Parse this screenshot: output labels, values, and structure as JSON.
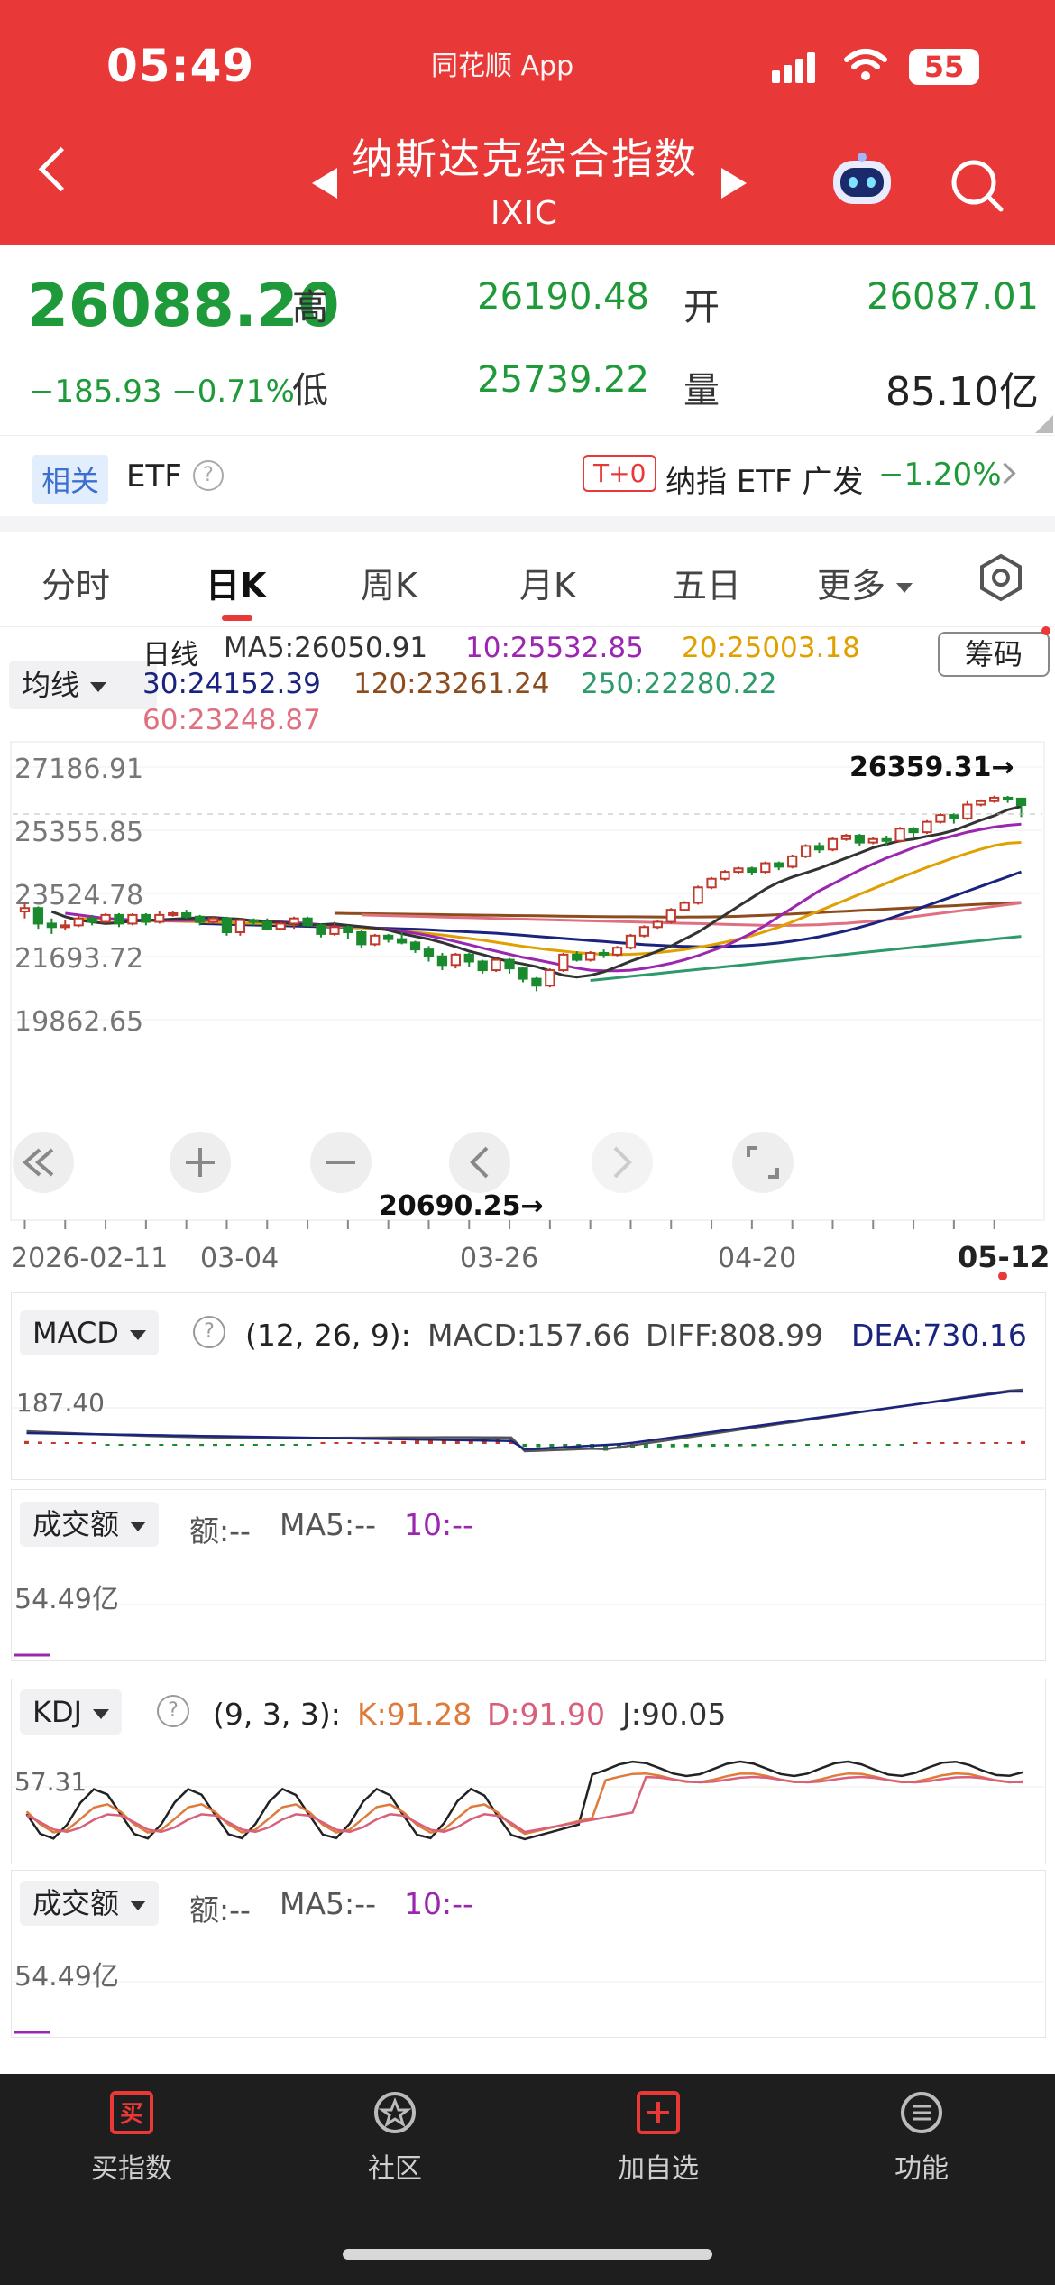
{
  "status_bar": {
    "time": "05:49",
    "app_name": "同花顺 App",
    "battery": "55"
  },
  "header": {
    "title": "纳斯达克综合指数",
    "code": "IXIC"
  },
  "quote": {
    "price": "26088.20",
    "change": "−185.93  −0.71%",
    "high_label": "高",
    "high": "26190.48",
    "open_label": "开",
    "open": "26087.01",
    "low_label": "低",
    "low": "25739.22",
    "volume_label": "量",
    "volume": "85.10亿"
  },
  "related": {
    "tag": "相关",
    "etf_label": "ETF",
    "t0": "T+0",
    "etf_name": "纳指 ETF 广发",
    "etf_change": "−1.20%"
  },
  "tabs": [
    {
      "label": "分时"
    },
    {
      "label": "日K"
    },
    {
      "label": "周K"
    },
    {
      "label": "月K"
    },
    {
      "label": "五日"
    },
    {
      "label": "更多"
    }
  ],
  "ma_legend": {
    "selector": "均线",
    "period": "日线",
    "ma5": "MA5:26050.91",
    "ma10": "10:25532.85",
    "ma20": "20:25003.18",
    "ma30": "30:24152.39",
    "ma120": "120:23261.24",
    "ma250": "250:22280.22",
    "ma60": "60:23248.87",
    "chip_button": "筹码"
  },
  "colors": {
    "up": "#c0392b",
    "down": "#1a8a2e",
    "ma5": "#333333",
    "ma10": "#9b27b0",
    "ma20": "#e0a000",
    "ma30": "#1a237e",
    "ma120": "#8d4c1e",
    "ma250": "#2e9a6b",
    "ma60": "#e07080"
  },
  "chart_data": {
    "type": "candlestick",
    "y_axis_labels": [
      "27186.91",
      "25355.85",
      "23524.78",
      "21693.72",
      "19862.65"
    ],
    "ylim": [
      19862.65,
      27186.91
    ],
    "x_axis_labels": [
      "2026-02-11",
      "03-04",
      "03-26",
      "04-20",
      "05-12"
    ],
    "annotations": {
      "high_marker": "26359.31→",
      "low_marker": "20690.25→"
    },
    "candles": [
      {
        "o": 23000,
        "c": 23100,
        "h": 23250,
        "l": 22800
      },
      {
        "o": 23100,
        "c": 22650,
        "h": 23150,
        "l": 22500
      },
      {
        "o": 22650,
        "c": 22550,
        "h": 22800,
        "l": 22350
      },
      {
        "o": 22550,
        "c": 22600,
        "h": 22750,
        "l": 22450
      },
      {
        "o": 22600,
        "c": 22800,
        "h": 22900,
        "l": 22550
      },
      {
        "o": 22800,
        "c": 22700,
        "h": 22900,
        "l": 22600
      },
      {
        "o": 22700,
        "c": 22900,
        "h": 22950,
        "l": 22650
      },
      {
        "o": 22900,
        "c": 22650,
        "h": 22950,
        "l": 22550
      },
      {
        "o": 22650,
        "c": 22900,
        "h": 22950,
        "l": 22600
      },
      {
        "o": 22900,
        "c": 22700,
        "h": 22950,
        "l": 22600
      },
      {
        "o": 22700,
        "c": 22900,
        "h": 23000,
        "l": 22650
      },
      {
        "o": 22900,
        "c": 22950,
        "h": 23000,
        "l": 22850
      },
      {
        "o": 22950,
        "c": 22850,
        "h": 23050,
        "l": 22800
      },
      {
        "o": 22850,
        "c": 22700,
        "h": 22900,
        "l": 22600
      },
      {
        "o": 22700,
        "c": 22800,
        "h": 22850,
        "l": 22650
      },
      {
        "o": 22800,
        "c": 22400,
        "h": 22850,
        "l": 22300
      },
      {
        "o": 22400,
        "c": 22750,
        "h": 22800,
        "l": 22300
      },
      {
        "o": 22750,
        "c": 22700,
        "h": 22800,
        "l": 22600
      },
      {
        "o": 22700,
        "c": 22500,
        "h": 22800,
        "l": 22450
      },
      {
        "o": 22500,
        "c": 22650,
        "h": 22700,
        "l": 22450
      },
      {
        "o": 22650,
        "c": 22800,
        "h": 22850,
        "l": 22500
      },
      {
        "o": 22800,
        "c": 22600,
        "h": 22850,
        "l": 22550
      },
      {
        "o": 22600,
        "c": 22350,
        "h": 22650,
        "l": 22250
      },
      {
        "o": 22350,
        "c": 22550,
        "h": 22700,
        "l": 22300
      },
      {
        "o": 22550,
        "c": 22400,
        "h": 22600,
        "l": 22200
      },
      {
        "o": 22400,
        "c": 22050,
        "h": 22450,
        "l": 21950
      },
      {
        "o": 22050,
        "c": 22300,
        "h": 22350,
        "l": 22000
      },
      {
        "o": 22300,
        "c": 22200,
        "h": 22350,
        "l": 22100
      },
      {
        "o": 22200,
        "c": 22100,
        "h": 22400,
        "l": 22050
      },
      {
        "o": 22100,
        "c": 21900,
        "h": 22150,
        "l": 21800
      },
      {
        "o": 21900,
        "c": 21700,
        "h": 22000,
        "l": 21550
      },
      {
        "o": 21700,
        "c": 21450,
        "h": 21800,
        "l": 21300
      },
      {
        "o": 21450,
        "c": 21750,
        "h": 21800,
        "l": 21350
      },
      {
        "o": 21750,
        "c": 21550,
        "h": 21800,
        "l": 21400
      },
      {
        "o": 21550,
        "c": 21300,
        "h": 21600,
        "l": 21200
      },
      {
        "o": 21300,
        "c": 21600,
        "h": 21650,
        "l": 21250
      },
      {
        "o": 21600,
        "c": 21350,
        "h": 21650,
        "l": 21200
      },
      {
        "o": 21350,
        "c": 21050,
        "h": 21400,
        "l": 20950
      },
      {
        "o": 21050,
        "c": 20850,
        "h": 21100,
        "l": 20690
      },
      {
        "o": 20850,
        "c": 21300,
        "h": 21350,
        "l": 20800
      },
      {
        "o": 21300,
        "c": 21750,
        "h": 21800,
        "l": 21250
      },
      {
        "o": 21750,
        "c": 21600,
        "h": 21850,
        "l": 21550
      },
      {
        "o": 21600,
        "c": 21800,
        "h": 21850,
        "l": 21550
      },
      {
        "o": 21800,
        "c": 21750,
        "h": 21900,
        "l": 21650
      },
      {
        "o": 21750,
        "c": 21950,
        "h": 22000,
        "l": 21700
      },
      {
        "o": 21950,
        "c": 22300,
        "h": 22350,
        "l": 21900
      },
      {
        "o": 22300,
        "c": 22550,
        "h": 22600,
        "l": 22250
      },
      {
        "o": 22550,
        "c": 22700,
        "h": 22750,
        "l": 22500
      },
      {
        "o": 22700,
        "c": 23050,
        "h": 23100,
        "l": 22650
      },
      {
        "o": 23050,
        "c": 23250,
        "h": 23300,
        "l": 23000
      },
      {
        "o": 23250,
        "c": 23700,
        "h": 23750,
        "l": 23200
      },
      {
        "o": 23700,
        "c": 23950,
        "h": 24000,
        "l": 23650
      },
      {
        "o": 23950,
        "c": 24150,
        "h": 24200,
        "l": 23900
      },
      {
        "o": 24150,
        "c": 24250,
        "h": 24300,
        "l": 24100
      },
      {
        "o": 24250,
        "c": 24150,
        "h": 24300,
        "l": 24050
      },
      {
        "o": 24150,
        "c": 24400,
        "h": 24450,
        "l": 24100
      },
      {
        "o": 24400,
        "c": 24300,
        "h": 24450,
        "l": 24200
      },
      {
        "o": 24300,
        "c": 24600,
        "h": 24650,
        "l": 24250
      },
      {
        "o": 24600,
        "c": 24900,
        "h": 24950,
        "l": 24550
      },
      {
        "o": 24900,
        "c": 24800,
        "h": 25000,
        "l": 24700
      },
      {
        "o": 24800,
        "c": 25100,
        "h": 25150,
        "l": 24750
      },
      {
        "o": 25100,
        "c": 25200,
        "h": 25250,
        "l": 25050
      },
      {
        "o": 25200,
        "c": 25000,
        "h": 25250,
        "l": 24900
      },
      {
        "o": 25000,
        "c": 25100,
        "h": 25150,
        "l": 24950
      },
      {
        "o": 25100,
        "c": 25050,
        "h": 25200,
        "l": 24900
      },
      {
        "o": 25050,
        "c": 25400,
        "h": 25450,
        "l": 25000
      },
      {
        "o": 25400,
        "c": 25300,
        "h": 25450,
        "l": 25150
      },
      {
        "o": 25300,
        "c": 25600,
        "h": 25650,
        "l": 25250
      },
      {
        "o": 25600,
        "c": 25800,
        "h": 25850,
        "l": 25550
      },
      {
        "o": 25800,
        "c": 25700,
        "h": 25850,
        "l": 25550
      },
      {
        "o": 25700,
        "c": 26100,
        "h": 26200,
        "l": 25650
      },
      {
        "o": 26100,
        "c": 26200,
        "h": 26250,
        "l": 26050
      },
      {
        "o": 26200,
        "c": 26300,
        "h": 26359,
        "l": 26150
      },
      {
        "o": 26300,
        "c": 26250,
        "h": 26350,
        "l": 26150
      },
      {
        "o": 26274,
        "c": 26088,
        "h": 26190,
        "l": 25739
      }
    ],
    "ma5": [
      23000,
      22850,
      22750,
      22700,
      22650,
      22680,
      22720,
      22740,
      22760,
      22780,
      22800,
      22820,
      22830,
      22800,
      22780,
      22730,
      22700,
      22680,
      22640,
      22600,
      22620,
      22640,
      22600,
      22560,
      22520,
      22460,
      22360,
      22280,
      22200,
      22100,
      21980,
      21850,
      21750,
      21640,
      21550,
      21480,
      21400,
      21280,
      21150,
      21100,
      21150,
      21250,
      21400,
      21560,
      21700,
      21850,
      22000,
      22200,
      22400,
      22650,
      22900,
      23150,
      23400,
      23650,
      23850,
      24000,
      24120,
      24250,
      24400,
      24550,
      24700,
      24850,
      24950,
      25050,
      25100,
      25180,
      25250,
      25350,
      25500,
      25650,
      25780,
      25950,
      26050
    ],
    "ma10": [
      22950,
      22900,
      22850,
      22800,
      22780,
      22760,
      22750,
      22740,
      22740,
      22740,
      22750,
      22760,
      22760,
      22760,
      22740,
      22720,
      22700,
      22680,
      22650,
      22620,
      22600,
      22580,
      22560,
      22520,
      22480,
      22430,
      22370,
      22300,
      22220,
      22130,
      22040,
      21940,
      21850,
      21760,
      21670,
      21600,
      21520,
      21440,
      21360,
      21300,
      21280,
      21280,
      21300,
      21350,
      21420,
      21500,
      21600,
      21720,
      21860,
      22000,
      22180,
      22380,
      22600,
      22850,
      23100,
      23350,
      23600,
      23800,
      24000,
      24200,
      24380,
      24550,
      24700,
      24850,
      24980,
      25100,
      25200,
      25300,
      25380,
      25450,
      25500,
      25530
    ],
    "ma20": [
      22800,
      22780,
      22770,
      22760,
      22750,
      22740,
      22730,
      22720,
      22710,
      22700,
      22690,
      22680,
      22670,
      22660,
      22650,
      22640,
      22630,
      22610,
      22590,
      22570,
      22550,
      22530,
      22500,
      22470,
      22440,
      22400,
      22360,
      22320,
      22270,
      22220,
      22170,
      22110,
      22050,
      21990,
      21940,
      21890,
      21850,
      21810,
      21780,
      21760,
      21750,
      21760,
      21780,
      21810,
      21850,
      21900,
      21960,
      22030,
      22110,
      22200,
      22300,
      22420,
      22550,
      22700,
      22860,
      23020,
      23180,
      23340,
      23500,
      23660,
      23820,
      23980,
      24130,
      24280,
      24420,
      24560,
      24690,
      24810,
      24910,
      24980,
      25003
    ],
    "ma30": [
      22650,
      22640,
      22630,
      22620,
      22610,
      22600,
      22590,
      22580,
      22570,
      22560,
      22550,
      22540,
      22530,
      22520,
      22510,
      22500,
      22490,
      22470,
      22450,
      22430,
      22410,
      22390,
      22370,
      22340,
      22310,
      22280,
      22250,
      22220,
      22190,
      22160,
      22130,
      22100,
      22070,
      22040,
      22020,
      22000,
      21990,
      21980,
      21980,
      21990,
      22000,
      22020,
      22050,
      22090,
      22140,
      22200,
      22270,
      22350,
      22440,
      22540,
      22650,
      22770,
      22900,
      23030,
      23170,
      23310,
      23450,
      23590,
      23730,
      23870,
      24010,
      24150
    ],
    "ma60": [
      22900,
      22890,
      22880,
      22870,
      22860,
      22850,
      22840,
      22830,
      22820,
      22810,
      22800,
      22790,
      22780,
      22770,
      22760,
      22750,
      22740,
      22730,
      22720,
      22710,
      22700,
      22690,
      22680,
      22670,
      22660,
      22650,
      22640,
      22630,
      22620,
      22610,
      22600,
      22600,
      22600,
      22610,
      22620,
      22640,
      22660,
      22690,
      22720,
      22760,
      22800,
      22850,
      22900,
      22950,
      23000,
      23050,
      23100,
      23150,
      23200,
      23249
    ],
    "ma120": [
      22950,
      22945,
      22940,
      22935,
      22930,
      22925,
      22920,
      22915,
      22910,
      22905,
      22900,
      22895,
      22890,
      22885,
      22880,
      22875,
      22870,
      22865,
      22860,
      22855,
      22850,
      22848,
      22846,
      22844,
      22842,
      22840,
      22840,
      22842,
      22845,
      22850,
      22860,
      22875,
      22890,
      22910,
      22930,
      22950,
      22970,
      22990,
      23010,
      23030,
      23050,
      23070,
      23090,
      23110,
      23130,
      23150,
      23170,
      23190,
      23210,
      23230,
      23250,
      23261
    ],
    "ma250": [
      21000,
      21040,
      21080,
      21120,
      21160,
      21200,
      21240,
      21280,
      21320,
      21360,
      21400,
      21440,
      21480,
      21520,
      21560,
      21600,
      21640,
      21680,
      21720,
      21760,
      21800,
      21840,
      21880,
      21920,
      21960,
      22000,
      22040,
      22080,
      22120,
      22160,
      22200,
      22240,
      22280
    ]
  },
  "macd": {
    "selector": "MACD",
    "params": "(12, 26, 9):",
    "macd": "MACD:157.66",
    "diff": "DIFF:808.99",
    "dea": "DEA:730.16",
    "axis_label": "187.40"
  },
  "volume_panel_1": {
    "selector": "成交额",
    "amount": "额:--",
    "ma5": "MA5:--",
    "ma10": "10:--",
    "axis_label": "54.49亿"
  },
  "kdj": {
    "selector": "KDJ",
    "params": "(9, 3, 3):",
    "k": "K:91.28",
    "d": "D:91.90",
    "j": "J:90.05",
    "axis_label": "57.31"
  },
  "volume_panel_2": {
    "selector": "成交额",
    "amount": "额:--",
    "ma5": "MA5:--",
    "ma10": "10:--",
    "axis_label": "54.49亿"
  },
  "bottom_nav": [
    {
      "label": "买指数",
      "icon": "buy-icon"
    },
    {
      "label": "社区",
      "icon": "community-icon"
    },
    {
      "label": "加自选",
      "icon": "add-watchlist-icon"
    },
    {
      "label": "功能",
      "icon": "menu-icon"
    }
  ],
  "nav_icon_buy_glyph": "买"
}
